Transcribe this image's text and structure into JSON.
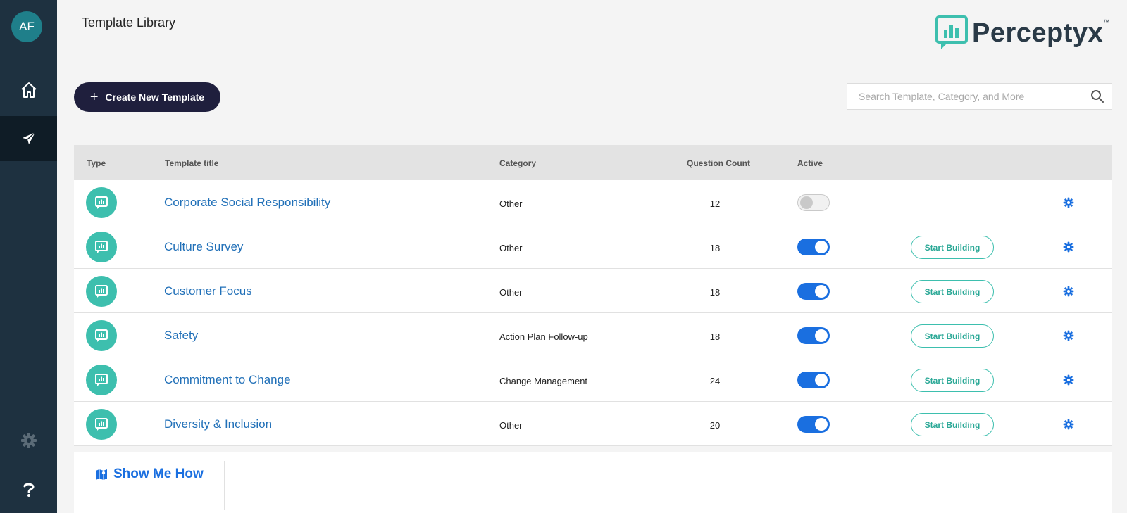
{
  "user": {
    "initials": "AF"
  },
  "page": {
    "title": "Template Library"
  },
  "brand": {
    "name": "Perceptyx",
    "tm": "™"
  },
  "toolbar": {
    "create_label": "Create New Template"
  },
  "search": {
    "placeholder": "Search Template, Category, and More"
  },
  "table": {
    "headers": {
      "type": "Type",
      "title": "Template title",
      "category": "Category",
      "question_count": "Question Count",
      "active": "Active"
    },
    "rows": [
      {
        "title": "Corporate Social Responsibility",
        "category": "Other",
        "question_count": "12",
        "active": false,
        "action": ""
      },
      {
        "title": "Culture Survey",
        "category": "Other",
        "question_count": "18",
        "active": true,
        "action": "Start Building"
      },
      {
        "title": "Customer Focus",
        "category": "Other",
        "question_count": "18",
        "active": true,
        "action": "Start Building"
      },
      {
        "title": "Safety",
        "category": "Action Plan Follow-up",
        "question_count": "18",
        "active": true,
        "action": "Start Building"
      },
      {
        "title": "Commitment to Change",
        "category": "Change Management",
        "question_count": "24",
        "active": true,
        "action": "Start Building"
      },
      {
        "title": "Diversity & Inclusion",
        "category": "Other",
        "question_count": "20",
        "active": true,
        "action": "Start Building"
      }
    ]
  },
  "footer": {
    "show_me_label": "Show Me How"
  },
  "colors": {
    "sidebar": "#1e3140",
    "accent": "#1a6fe0",
    "teal": "#3dbfae",
    "primary_button": "#1f1f3d",
    "link": "#2170b8"
  },
  "icons": [
    "home-icon",
    "paper-plane-icon",
    "gear-icon",
    "question-icon",
    "search-icon",
    "survey-chart-icon",
    "map-icon",
    "plus-icon"
  ]
}
